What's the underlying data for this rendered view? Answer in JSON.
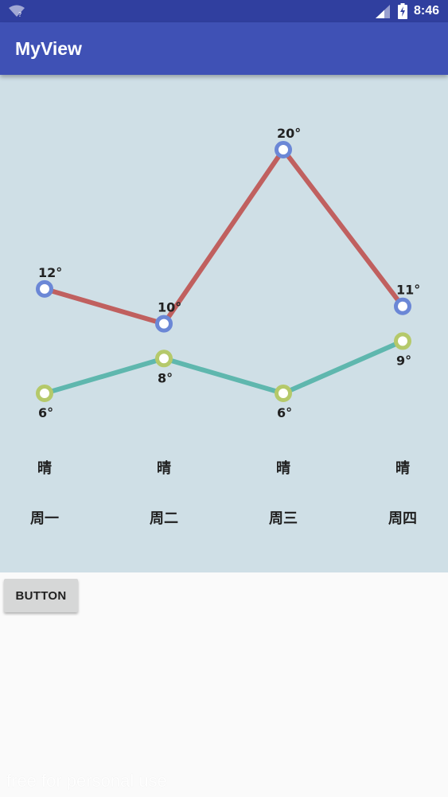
{
  "status_bar": {
    "time": "8:46",
    "icons": [
      "wifi-icon",
      "cell-signal-icon",
      "battery-charging-icon"
    ]
  },
  "app_bar": {
    "title": "MyView"
  },
  "chart_data": {
    "type": "line",
    "categories": [
      "周一",
      "周二",
      "周三",
      "周四"
    ],
    "weather": [
      "晴",
      "晴",
      "晴",
      "晴"
    ],
    "series": [
      {
        "values": [
          12,
          10,
          20,
          11
        ],
        "color": "#c0605f",
        "marker_color": "#6b87d6",
        "unit": "°"
      },
      {
        "values": [
          6,
          8,
          6,
          9
        ],
        "color": "#5fb7ae",
        "marker_color": "#b5c96a",
        "unit": "°"
      }
    ],
    "title": "",
    "xlabel": "",
    "ylabel": "",
    "ylim": [
      6,
      20
    ],
    "grid": false,
    "legend": "none"
  },
  "button": {
    "label": "BUTTON"
  },
  "watermark": {
    "text": "free for personal use"
  },
  "colors": {
    "status_bar": "#303f9f",
    "app_bar": "#3f51b5",
    "panel_background": "#cfdfe6",
    "page_background": "#fafafa"
  }
}
